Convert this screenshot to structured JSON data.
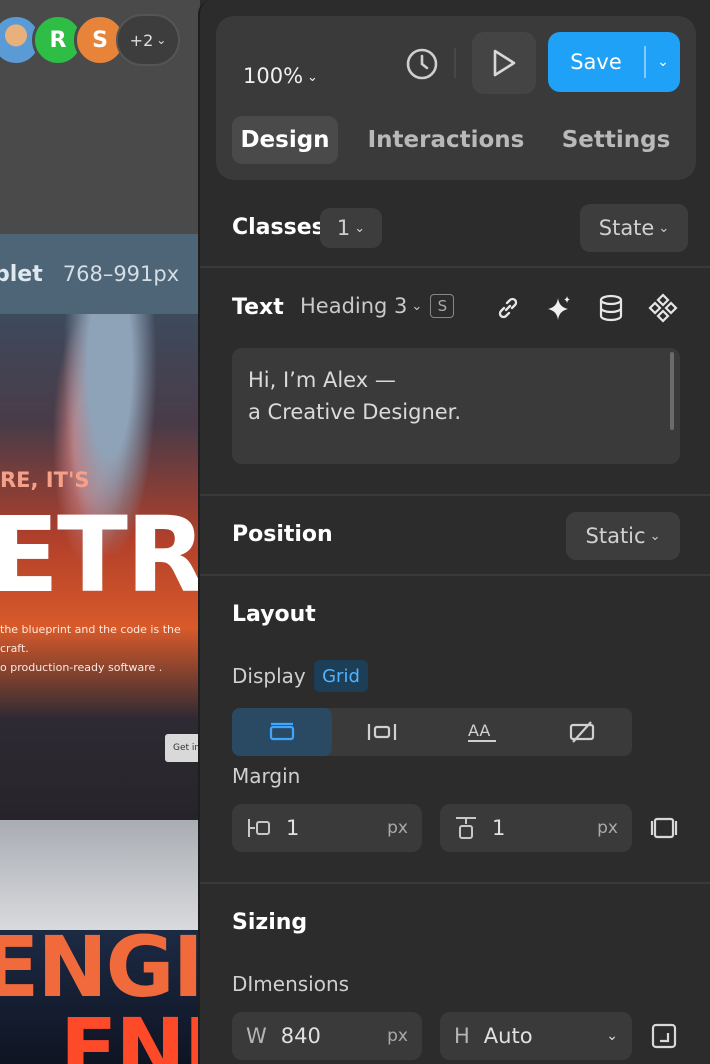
{
  "canvas": {
    "avatars": [
      {
        "initial": "",
        "color": "#5a9bd6"
      },
      {
        "initial": "R",
        "color": "#2ebd45"
      },
      {
        "initial": "S",
        "color": "#e8843a"
      }
    ],
    "more_users": "+2",
    "breakpoint_name": "blet",
    "breakpoint_range": "768–991px",
    "hero_small": "RE, IT'S",
    "hero_big": "ETR",
    "hero_copy_1": "the blueprint and the code is the craft.",
    "hero_copy_2": "o production-ready software .",
    "get_in": "Get in",
    "engine_1": "ENGIN",
    "engine_2": "ENE"
  },
  "toolbar": {
    "zoom": "100%",
    "save_label": "Save"
  },
  "tabs": [
    {
      "label": "Design",
      "active": true
    },
    {
      "label": "Interactions",
      "active": false
    },
    {
      "label": "Settings",
      "active": false
    }
  ],
  "classes": {
    "title": "Classes",
    "count": "1",
    "state_label": "State"
  },
  "text_section": {
    "title": "Text",
    "tag": "Heading 3",
    "badge": "S",
    "content_line1": "Hi, I’m Alex —",
    "content_line2": "a Creative Designer."
  },
  "position": {
    "title": "Position",
    "value": "Static"
  },
  "layout": {
    "title": "Layout",
    "display_label": "Display",
    "display_value": "Grid",
    "margin_label": "Margin",
    "margin_left_value": "1",
    "margin_left_unit": "px",
    "margin_top_value": "1",
    "margin_top_unit": "px"
  },
  "sizing": {
    "title": "Sizing",
    "dimensions_label": "DImensions",
    "width_prefix": "W",
    "width_value": "840",
    "width_unit": "px",
    "height_prefix": "H",
    "height_value": "Auto"
  },
  "colors": {
    "accent": "#1ea1f7",
    "panel_bg": "#2c2c2c",
    "grid_badge_text": "#4fb3ff"
  }
}
